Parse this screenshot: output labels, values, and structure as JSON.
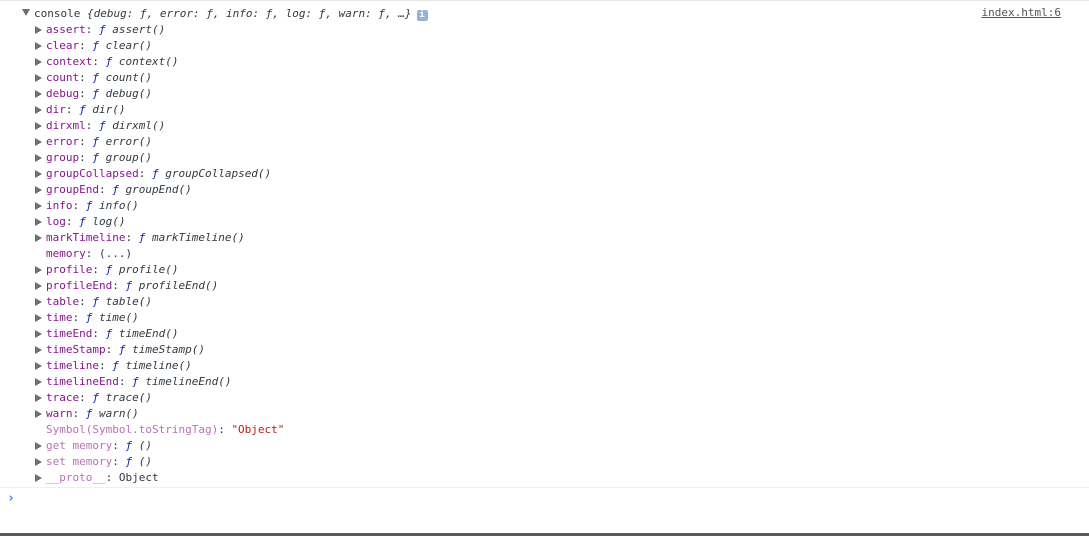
{
  "source_link": "index.html:6",
  "header": {
    "name": "console",
    "preview": "{debug: ƒ, error: ƒ, info: ƒ, log: ƒ, warn: ƒ, …}",
    "info_badge": "i"
  },
  "properties": [
    {
      "key": "assert",
      "value": "assert()",
      "type": "function",
      "expandable": true
    },
    {
      "key": "clear",
      "value": "clear()",
      "type": "function",
      "expandable": true
    },
    {
      "key": "context",
      "value": "context()",
      "type": "function",
      "expandable": true
    },
    {
      "key": "count",
      "value": "count()",
      "type": "function",
      "expandable": true
    },
    {
      "key": "debug",
      "value": "debug()",
      "type": "function",
      "expandable": true
    },
    {
      "key": "dir",
      "value": "dir()",
      "type": "function",
      "expandable": true
    },
    {
      "key": "dirxml",
      "value": "dirxml()",
      "type": "function",
      "expandable": true
    },
    {
      "key": "error",
      "value": "error()",
      "type": "function",
      "expandable": true
    },
    {
      "key": "group",
      "value": "group()",
      "type": "function",
      "expandable": true
    },
    {
      "key": "groupCollapsed",
      "value": "groupCollapsed()",
      "type": "function",
      "expandable": true
    },
    {
      "key": "groupEnd",
      "value": "groupEnd()",
      "type": "function",
      "expandable": true
    },
    {
      "key": "info",
      "value": "info()",
      "type": "function",
      "expandable": true
    },
    {
      "key": "log",
      "value": "log()",
      "type": "function",
      "expandable": true
    },
    {
      "key": "markTimeline",
      "value": "markTimeline()",
      "type": "function",
      "expandable": true
    },
    {
      "key": "memory",
      "value": "(...)",
      "type": "plain",
      "expandable": false
    },
    {
      "key": "profile",
      "value": "profile()",
      "type": "function",
      "expandable": true
    },
    {
      "key": "profileEnd",
      "value": "profileEnd()",
      "type": "function",
      "expandable": true
    },
    {
      "key": "table",
      "value": "table()",
      "type": "function",
      "expandable": true
    },
    {
      "key": "time",
      "value": "time()",
      "type": "function",
      "expandable": true
    },
    {
      "key": "timeEnd",
      "value": "timeEnd()",
      "type": "function",
      "expandable": true
    },
    {
      "key": "timeStamp",
      "value": "timeStamp()",
      "type": "function",
      "expandable": true
    },
    {
      "key": "timeline",
      "value": "timeline()",
      "type": "function",
      "expandable": true
    },
    {
      "key": "timelineEnd",
      "value": "timelineEnd()",
      "type": "function",
      "expandable": true
    },
    {
      "key": "trace",
      "value": "trace()",
      "type": "function",
      "expandable": true
    },
    {
      "key": "warn",
      "value": "warn()",
      "type": "function",
      "expandable": true
    },
    {
      "key": "Symbol(Symbol.toStringTag)",
      "value": "\"Object\"",
      "type": "string",
      "expandable": false,
      "dim": true
    },
    {
      "key": "get memory",
      "value": "()",
      "type": "function",
      "expandable": true,
      "dim": true
    },
    {
      "key": "set memory",
      "value": "()",
      "type": "function",
      "expandable": true,
      "dim": true
    },
    {
      "key": "__proto__",
      "value": "Object",
      "type": "plain",
      "expandable": true,
      "dim": true
    }
  ],
  "function_symbol": "ƒ",
  "prompt_symbol": "›",
  "colors": {
    "key": "#881391",
    "key_dim": "#b871b6",
    "function_symbol": "#0d22aa",
    "string": "#c41a16",
    "prompt": "#367cf1"
  }
}
